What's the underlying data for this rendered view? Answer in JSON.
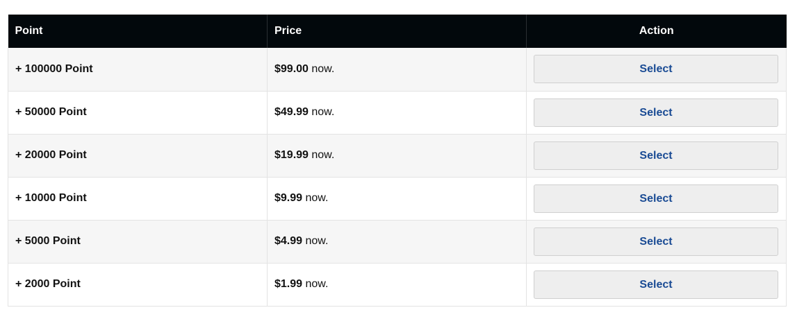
{
  "table": {
    "headers": {
      "point": "Point",
      "price": "Price",
      "action": "Action"
    },
    "rows": [
      {
        "point": "+ 100000 Point",
        "price": "$99.00",
        "suffix": " now.",
        "action": "Select"
      },
      {
        "point": "+ 50000 Point",
        "price": "$49.99",
        "suffix": " now.",
        "action": "Select"
      },
      {
        "point": "+ 20000 Point",
        "price": "$19.99",
        "suffix": " now.",
        "action": "Select"
      },
      {
        "point": "+ 10000 Point",
        "price": "$9.99",
        "suffix": " now.",
        "action": "Select"
      },
      {
        "point": "+ 5000 Point",
        "price": "$4.99",
        "suffix": " now.",
        "action": "Select"
      },
      {
        "point": "+ 2000 Point",
        "price": "$1.99",
        "suffix": " now.",
        "action": "Select"
      }
    ]
  },
  "colors": {
    "header_bg": "#02080c",
    "header_text": "#ffffff",
    "row_alt_bg": "#f6f6f6",
    "button_bg": "#eeeeee",
    "button_text": "#1a4b94"
  }
}
